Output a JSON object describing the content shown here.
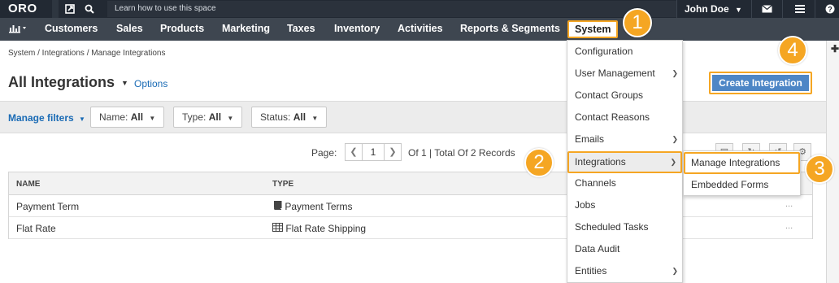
{
  "topbar": {
    "logo": "ORO",
    "learn_text": "Learn how to use this space",
    "user_name": "John Doe"
  },
  "mainmenu": {
    "items": [
      "Customers",
      "Sales",
      "Products",
      "Marketing",
      "Taxes",
      "Inventory",
      "Activities",
      "Reports & Segments",
      "System"
    ]
  },
  "breadcrumb": "System / Integrations / Manage Integrations",
  "page": {
    "title": "All Integrations",
    "options": "Options",
    "create_button": "Create Integration"
  },
  "filters": {
    "manage": "Manage filters",
    "name_label": "Name:",
    "name_value": "All",
    "type_label": "Type:",
    "type_value": "All",
    "status_label": "Status:",
    "status_value": "All"
  },
  "pager": {
    "label": "Page:",
    "current": "1",
    "info": "Of 1 | Total Of 2 Records"
  },
  "grid": {
    "columns": [
      "NAME",
      "TYPE"
    ],
    "rows": [
      {
        "name": "Payment Term",
        "type": "Payment Terms",
        "type_icon": "book-icon",
        "actions": "..."
      },
      {
        "name": "Flat Rate",
        "type": "Flat Rate Shipping",
        "type_icon": "table-icon",
        "actions": "..."
      }
    ]
  },
  "system_menu": {
    "items": [
      "Configuration",
      "User Management",
      "Contact Groups",
      "Contact Reasons",
      "Emails",
      "Integrations",
      "Channels",
      "Jobs",
      "Scheduled Tasks",
      "Data Audit",
      "Entities"
    ]
  },
  "submenu": {
    "items": [
      "Manage Integrations",
      "Embedded Forms"
    ]
  },
  "callouts": [
    "1",
    "2",
    "3",
    "4"
  ],
  "colors": {
    "highlight": "#f5a623",
    "topbar": "#222933",
    "menubar": "#3e4650",
    "link": "#1a6bb5",
    "primary_button": "#4d86c6"
  }
}
